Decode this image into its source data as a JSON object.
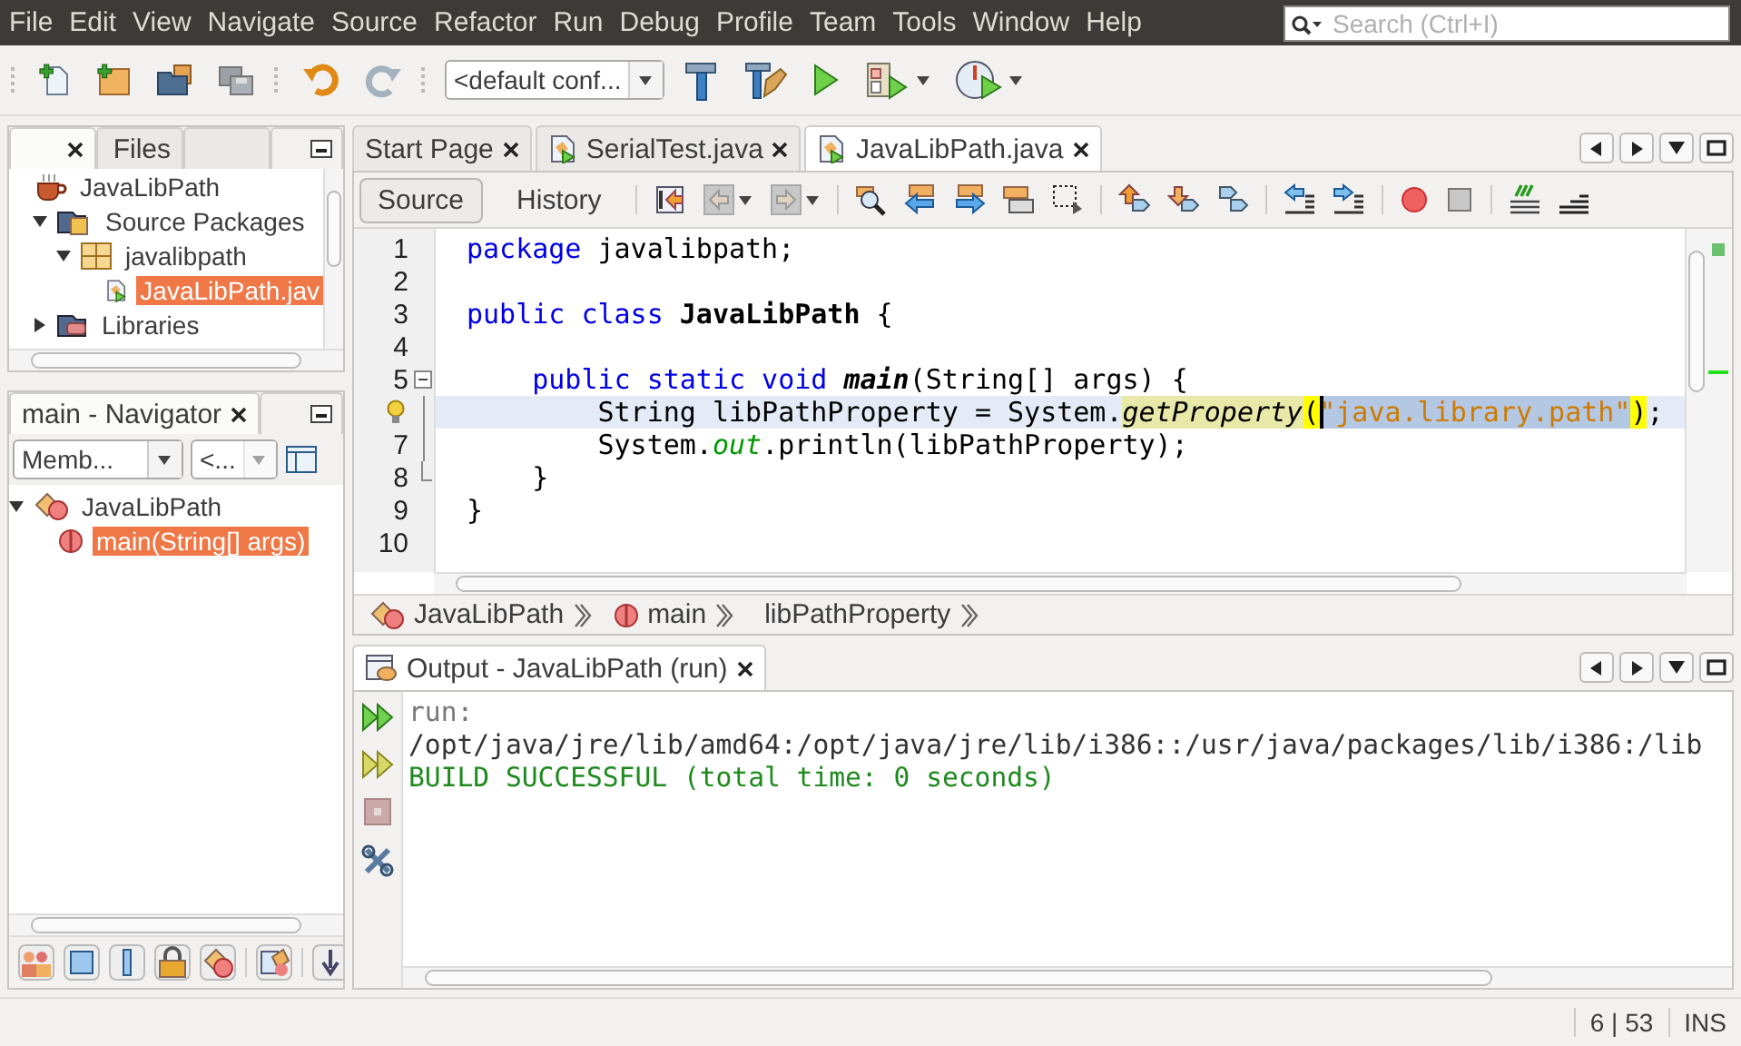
{
  "menu": [
    "File",
    "Edit",
    "View",
    "Navigate",
    "Source",
    "Refactor",
    "Run",
    "Debug",
    "Profile",
    "Team",
    "Tools",
    "Window",
    "Help"
  ],
  "search": {
    "placeholder": "Search (Ctrl+I)"
  },
  "toolbar": {
    "config": "<default conf..."
  },
  "projects_panel": {
    "tabs": [
      {
        "closable": true,
        "selected": true
      },
      {
        "label": "Files",
        "closable": false,
        "selected": false
      },
      {
        "closable": false,
        "selected": false
      }
    ],
    "tree": [
      {
        "label": "JavaLibPath",
        "kind": "project",
        "selected": false,
        "children": [
          {
            "label": "Source Packages",
            "kind": "source-root",
            "expanded": true,
            "selected": false,
            "children": [
              {
                "label": "javalibpath",
                "kind": "package",
                "expanded": true,
                "selected": false,
                "children": [
                  {
                    "label": "JavaLibPath.jav",
                    "kind": "java-file",
                    "selected": true
                  }
                ]
              }
            ]
          },
          {
            "label": "Libraries",
            "kind": "libraries",
            "expanded": false,
            "selected": false
          }
        ]
      }
    ]
  },
  "navigator": {
    "title": "main - Navigator",
    "members_filter": "Memb...",
    "scope_filter": "<...",
    "tree": [
      {
        "label": "JavaLibPath",
        "kind": "class",
        "expanded": true,
        "selected": false,
        "children": [
          {
            "label": "main(String[] args)",
            "kind": "method",
            "selected": true
          }
        ]
      }
    ]
  },
  "editor": {
    "tabs": [
      {
        "label": "Start Page",
        "kind": "page",
        "selected": false
      },
      {
        "label": "SerialTest.java",
        "kind": "java",
        "selected": false
      },
      {
        "label": "JavaLibPath.java",
        "kind": "java",
        "selected": true
      }
    ],
    "modes": [
      {
        "label": "Source",
        "selected": true
      },
      {
        "label": "History",
        "selected": false
      }
    ],
    "lines": [
      {
        "number": "1",
        "current": false,
        "hint": false,
        "kind": "plain",
        "tokens": [
          {
            "kind": "keyword",
            "text": "package"
          },
          {
            "kind": "text",
            "text": " javalibpath;"
          }
        ]
      },
      {
        "number": "2",
        "current": false,
        "hint": false,
        "kind": "plain"
      },
      {
        "number": "3",
        "current": false,
        "hint": false,
        "kind": "plain",
        "tokens": [
          {
            "kind": "keyword",
            "text": "public class "
          },
          {
            "kind": "class-name",
            "text": "JavaLibPath"
          },
          {
            "kind": "text",
            "text": " {"
          }
        ]
      },
      {
        "number": "4",
        "current": false,
        "hint": false,
        "kind": "plain"
      },
      {
        "number": "5",
        "current": false,
        "hint": false,
        "kind": "fold-start",
        "tokens": [
          {
            "kind": "keyword",
            "text": "    public static void "
          },
          {
            "kind": "method-decl",
            "text": "main"
          },
          {
            "kind": "text",
            "text": "(String[] args) {"
          }
        ]
      },
      {
        "current": true,
        "hint": true,
        "kind": "fold-body",
        "tokens": [
          {
            "kind": "text",
            "text": "        String libPathProperty = System."
          },
          {
            "kind": "method-call",
            "text": "getProperty"
          },
          {
            "kind": "brace-match",
            "text": "("
          },
          {
            "kind": "selected-string",
            "text": "\"java.library.path\"",
            "caret": true
          },
          {
            "kind": "brace-match",
            "text": ")"
          },
          {
            "kind": "text",
            "text": ";"
          }
        ]
      },
      {
        "number": "7",
        "current": false,
        "hint": false,
        "kind": "fold-body",
        "tokens": [
          {
            "kind": "text",
            "text": "        System."
          },
          {
            "kind": "static-field",
            "text": "out"
          },
          {
            "kind": "text",
            "text": ".println(libPathProperty);"
          }
        ]
      },
      {
        "number": "8",
        "current": false,
        "hint": false,
        "kind": "fold-end",
        "tokens": [
          {
            "kind": "text",
            "text": "    }"
          }
        ]
      },
      {
        "number": "9",
        "current": false,
        "hint": false,
        "kind": "plain",
        "tokens": [
          {
            "kind": "text",
            "text": "}"
          }
        ]
      },
      {
        "number": "10",
        "current": false,
        "hint": false,
        "kind": "plain"
      }
    ],
    "breadcrumbs": [
      {
        "label": "JavaLibPath",
        "kind": "class"
      },
      {
        "label": "main",
        "kind": "method"
      },
      {
        "label": "libPathProperty",
        "kind": "variable"
      }
    ]
  },
  "output": {
    "title": "Output - JavaLibPath (run)",
    "lines": [
      {
        "kind": "info",
        "text": "run:"
      },
      {
        "kind": "normal",
        "text": "/opt/java/jre/lib/amd64:/opt/java/jre/lib/i386::/usr/java/packages/lib/i386:/lib"
      },
      {
        "kind": "success",
        "text": "BUILD SUCCESSFUL (total time: 0 seconds)"
      }
    ]
  },
  "status_bar": {
    "position": "6 | 53",
    "mode": "INS"
  }
}
